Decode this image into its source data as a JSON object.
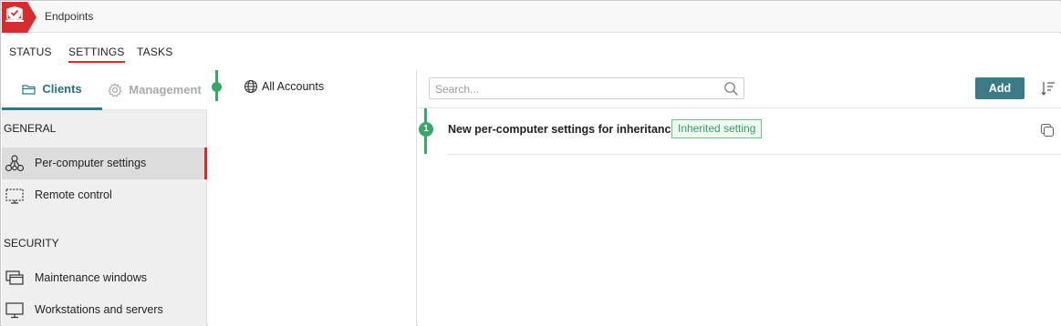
{
  "app": {
    "title": "Endpoints",
    "brand_color": "#d32d2d"
  },
  "topnav": {
    "tabs": [
      {
        "label": "STATUS",
        "active": false
      },
      {
        "label": "SETTINGS",
        "active": true
      },
      {
        "label": "TASKS",
        "active": false
      }
    ]
  },
  "sidebar": {
    "subtabs": [
      {
        "label": "Clients",
        "icon": "folder-icon",
        "active": true
      },
      {
        "label": "Management",
        "icon": "gear-icon",
        "active": false
      }
    ],
    "sections": [
      {
        "title": "GENERAL",
        "items": [
          {
            "label": "Per-computer settings",
            "icon": "network-nodes-icon",
            "active": true
          },
          {
            "label": "Remote control",
            "icon": "remote-screen-icon",
            "active": false
          }
        ]
      },
      {
        "title": "SECURITY",
        "items": [
          {
            "label": "Maintenance windows",
            "icon": "windows-stack-icon",
            "active": false
          },
          {
            "label": "Workstations and servers",
            "icon": "monitor-icon",
            "active": false
          }
        ]
      }
    ]
  },
  "tree": {
    "node_label": "All Accounts",
    "node_icon": "globe-icon"
  },
  "content": {
    "search_placeholder": "Search...",
    "add_label": "Add",
    "rows": [
      {
        "index": "1",
        "title": "New per-computer settings for inheritance",
        "badge": "Inherited setting"
      }
    ]
  },
  "colors": {
    "accent_teal": "#3a7b86",
    "status_green": "#3aa66a",
    "active_red": "#d32d2d"
  }
}
